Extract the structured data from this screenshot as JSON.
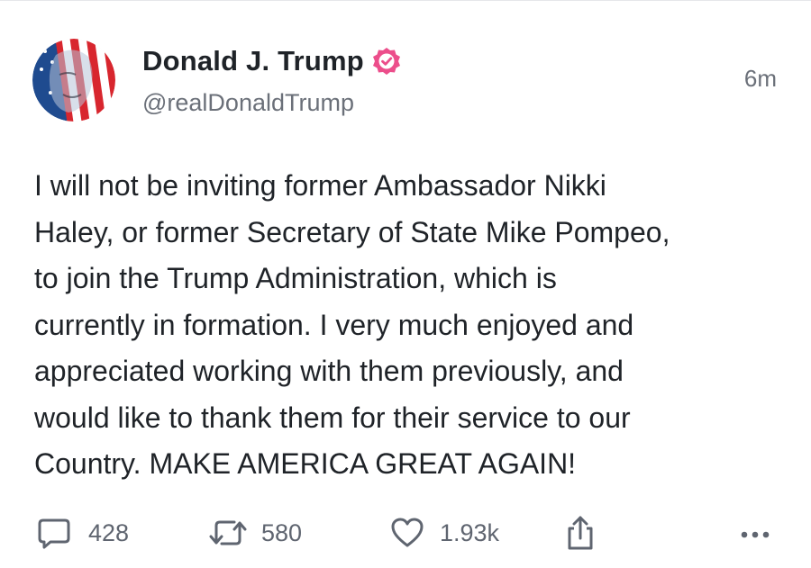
{
  "post": {
    "author_name": "Donald J. Trump",
    "handle": "@realDonaldTrump",
    "timestamp": "6m",
    "verified": true,
    "badge_color": "#ec4e8b",
    "avatar_icon": "flag-face-avatar",
    "text": "I will not be inviting former Ambassador Nikki\nHaley, or former Secretary of State Mike Pompeo,\nto join the Trump Administration, which is\ncurrently in formation. I very much enjoyed and\nappreciated working with them previously, and\nwould like to thank them for their service to our\nCountry. MAKE AMERICA GREAT AGAIN!"
  },
  "actions": {
    "reply_count": "428",
    "retruth_count": "580",
    "like_count": "1.93k",
    "reply_icon": "comment-bubble-icon",
    "retruth_icon": "retruth-icon",
    "like_icon": "heart-icon",
    "share_icon": "share-icon",
    "more_icon": "more-dots-icon"
  },
  "colors": {
    "text": "#1f2328",
    "muted": "#6b7079",
    "icon": "#5f6570"
  }
}
